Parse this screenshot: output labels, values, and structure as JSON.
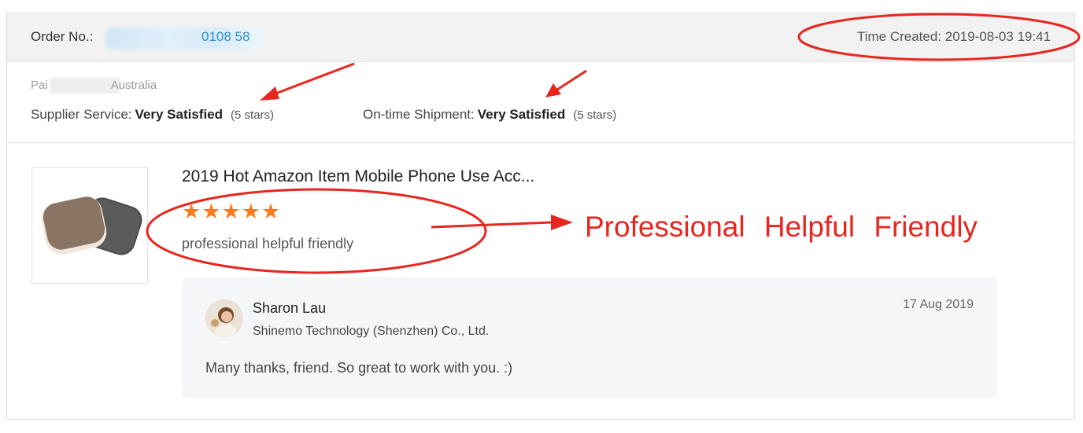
{
  "header": {
    "order_label": "Order No.:",
    "order_number_partial": "0108 58",
    "time_created": "Time Created: 2019-08-03 19:41"
  },
  "buyer": {
    "name_start": "Pai",
    "name_end": "Australia"
  },
  "ratings": {
    "supplier_service_label": "Supplier Service:",
    "supplier_service_value": "Very Satisfied",
    "supplier_service_stars": "(5 stars)",
    "shipment_label": "On-time Shipment:",
    "shipment_value": "Very Satisfied",
    "shipment_stars": "(5 stars)"
  },
  "product": {
    "title": "2019 Hot Amazon Item Mobile Phone Use Acc...",
    "star_rating": 5,
    "star_glyph": "★",
    "review_text": "professional helpful friendly"
  },
  "reply": {
    "name": "Sharon Lau",
    "company": "Shinemo Technology (Shenzhen) Co., Ltd.",
    "date": "17 Aug 2019",
    "text": "Many thanks, friend. So great to work with you. :)"
  },
  "annotation": {
    "text": "Professional Helpful Friendly",
    "color": "#e8251e"
  },
  "colors": {
    "link": "#2f8ed6",
    "star": "#ff7a1a",
    "header_bg": "#f2f2f2"
  }
}
